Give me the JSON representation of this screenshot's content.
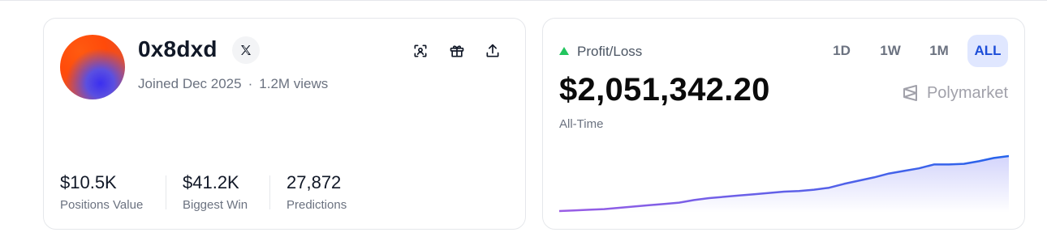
{
  "profile": {
    "username": "0x8dxd",
    "joined": "Joined Dec 2025",
    "separator": "·",
    "views": "1.2M views",
    "stats": [
      {
        "value": "$10.5K",
        "label": "Positions Value"
      },
      {
        "value": "$41.2K",
        "label": "Biggest Win"
      },
      {
        "value": "27,872",
        "label": "Predictions"
      }
    ],
    "icons": [
      "x-logo-icon",
      "scan-icon",
      "gift-icon",
      "share-icon"
    ]
  },
  "pnl": {
    "label": "Profit/Loss",
    "amount": "$2,051,342.20",
    "period": "All-Time",
    "brand": "Polymarket",
    "ranges": [
      "1D",
      "1W",
      "1M",
      "ALL"
    ],
    "active_range": "ALL",
    "colors": {
      "up": "#22c55e",
      "line_start": "#9b5de5",
      "line_end": "#2563eb",
      "active_bg": "#e0e7ff"
    }
  },
  "chart_data": {
    "type": "area",
    "x": [
      0,
      1,
      2,
      3,
      4,
      5,
      6,
      7,
      8,
      9,
      10,
      11,
      12,
      13,
      14,
      15,
      16,
      17,
      18,
      19,
      20,
      21,
      22,
      23,
      24,
      25,
      26,
      27,
      28,
      29,
      30
    ],
    "values": [
      0,
      0.01,
      0.02,
      0.03,
      0.05,
      0.07,
      0.09,
      0.11,
      0.13,
      0.17,
      0.2,
      0.22,
      0.24,
      0.26,
      0.28,
      0.3,
      0.31,
      0.33,
      0.36,
      0.42,
      0.47,
      0.52,
      0.58,
      0.62,
      0.66,
      0.72,
      0.72,
      0.73,
      0.77,
      0.82,
      0.85
    ],
    "ylim": [
      0,
      1
    ]
  }
}
